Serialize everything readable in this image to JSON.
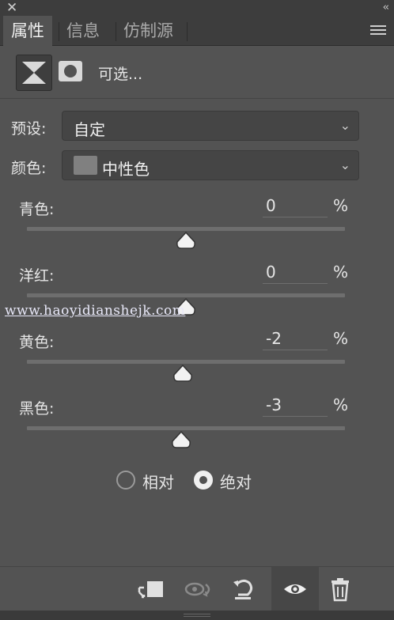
{
  "panel": {
    "close_glyph": "✕",
    "collapse_glyph": "‹‹",
    "tabs": [
      {
        "label": "属性",
        "active": true
      },
      {
        "label": "信息",
        "active": false
      },
      {
        "label": "仿制源",
        "active": false
      }
    ],
    "menu_icon": "hamburger-menu-icon"
  },
  "header": {
    "adjustment_name": "可选..."
  },
  "preset": {
    "label": "预设:",
    "value": "自定"
  },
  "colors": {
    "label": "颜色:",
    "value": "中性色",
    "swatch_color": "#808080"
  },
  "sliders": [
    {
      "label": "青色:",
      "value": "0",
      "unit": "%",
      "level": 0
    },
    {
      "label": "洋红:",
      "value": "0",
      "unit": "%",
      "level": 0
    },
    {
      "label": "黄色:",
      "value": "-2",
      "unit": "%",
      "level": -2
    },
    {
      "label": "黑色:",
      "value": "-3",
      "unit": "%",
      "level": -3
    }
  ],
  "method": {
    "options": [
      {
        "label": "相对",
        "selected": false
      },
      {
        "label": "绝对",
        "selected": true
      }
    ]
  },
  "watermark": "www.haoyidianshejk.com",
  "footer": {
    "buttons": [
      "clip-to-layer-icon",
      "view-previous-state-icon",
      "reset-icon",
      "visibility-eye-icon",
      "trash-icon"
    ]
  }
}
